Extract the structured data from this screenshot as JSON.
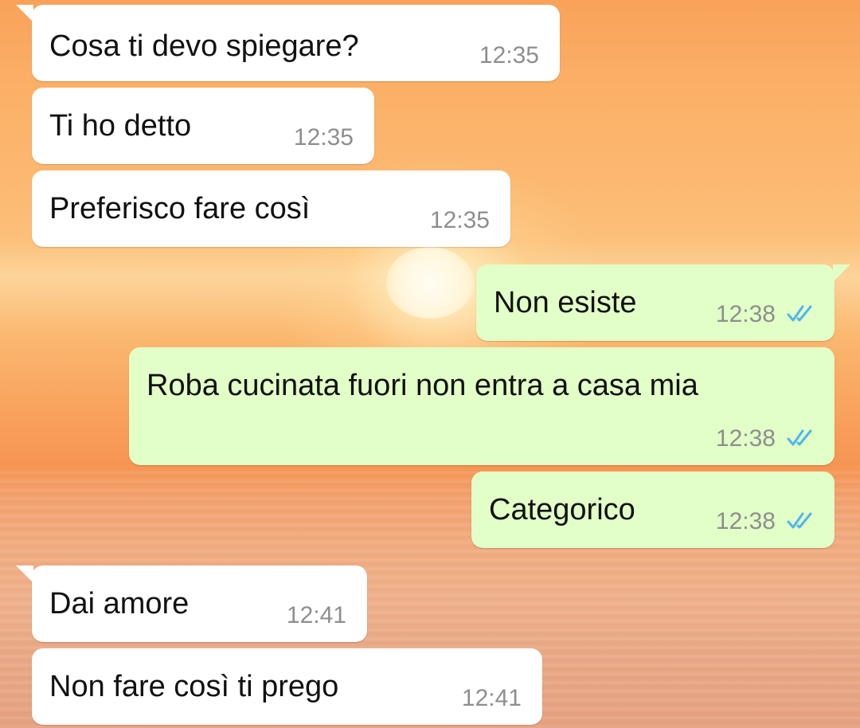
{
  "messages": [
    {
      "text": "Cosa ti devo spiegare?",
      "time": "12:35",
      "direction": "incoming"
    },
    {
      "text": "Ti ho detto",
      "time": "12:35",
      "direction": "incoming"
    },
    {
      "text": "Preferisco fare così",
      "time": "12:35",
      "direction": "incoming"
    },
    {
      "text": "Non esiste",
      "time": "12:38",
      "direction": "outgoing",
      "status": "read"
    },
    {
      "text": "Roba cucinata fuori non entra a casa mia",
      "time": "12:38",
      "direction": "outgoing",
      "status": "read"
    },
    {
      "text": "Categorico",
      "time": "12:38",
      "direction": "outgoing",
      "status": "read"
    },
    {
      "text": "Dai amore",
      "time": "12:41",
      "direction": "incoming"
    },
    {
      "text": "Non fare così ti prego",
      "time": "12:41",
      "direction": "incoming"
    }
  ],
  "colors": {
    "incoming_bubble": "#ffffff",
    "outgoing_bubble": "#e2ffc7",
    "read_ticks": "#4fb6ec",
    "timestamp": "#8e8e8e"
  },
  "icons": {
    "read_status": "double-check-icon"
  }
}
